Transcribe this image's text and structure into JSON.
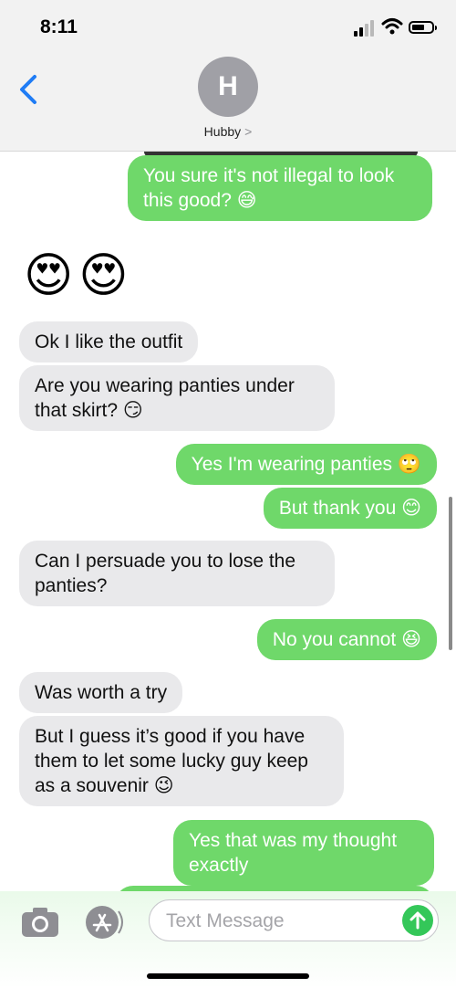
{
  "status_bar": {
    "time": "8:11"
  },
  "header": {
    "back_icon": "chevron-left-icon",
    "avatar_initial": "H",
    "contact_name": "Hubby",
    "contact_chevron": ">"
  },
  "messages": [
    {
      "from": "me",
      "text": "You sure it's not illegal to look this good? 😅"
    },
    {
      "from": "them",
      "text": "😍😍"
    },
    {
      "from": "them",
      "text": "Ok I like the outfit"
    },
    {
      "from": "them",
      "text": "Are you wearing panties under that skirt? 😏"
    },
    {
      "from": "me",
      "text": "Yes I'm wearing panties 🙄"
    },
    {
      "from": "me",
      "text": "But thank you 😊"
    },
    {
      "from": "them",
      "text": "Can I persuade you to lose the panties?"
    },
    {
      "from": "me",
      "text": "No you cannot 😆"
    },
    {
      "from": "them",
      "text": "Was worth a try"
    },
    {
      "from": "them",
      "text": "But I guess it’s good if you have them to let some lucky guy keep as a souvenir 😉"
    },
    {
      "from": "me",
      "text": "Yes that was my thought exactly"
    }
  ],
  "compose": {
    "placeholder": "Text Message",
    "value": "",
    "camera_icon": "camera-icon",
    "apps_icon": "app-store-icon",
    "send_icon": "send-arrow-icon"
  },
  "colors": {
    "outgoing_bubble": "#6fd86a",
    "incoming_bubble": "#e9e9eb",
    "accent": "#1f7cf5",
    "send_button": "#34c759"
  }
}
